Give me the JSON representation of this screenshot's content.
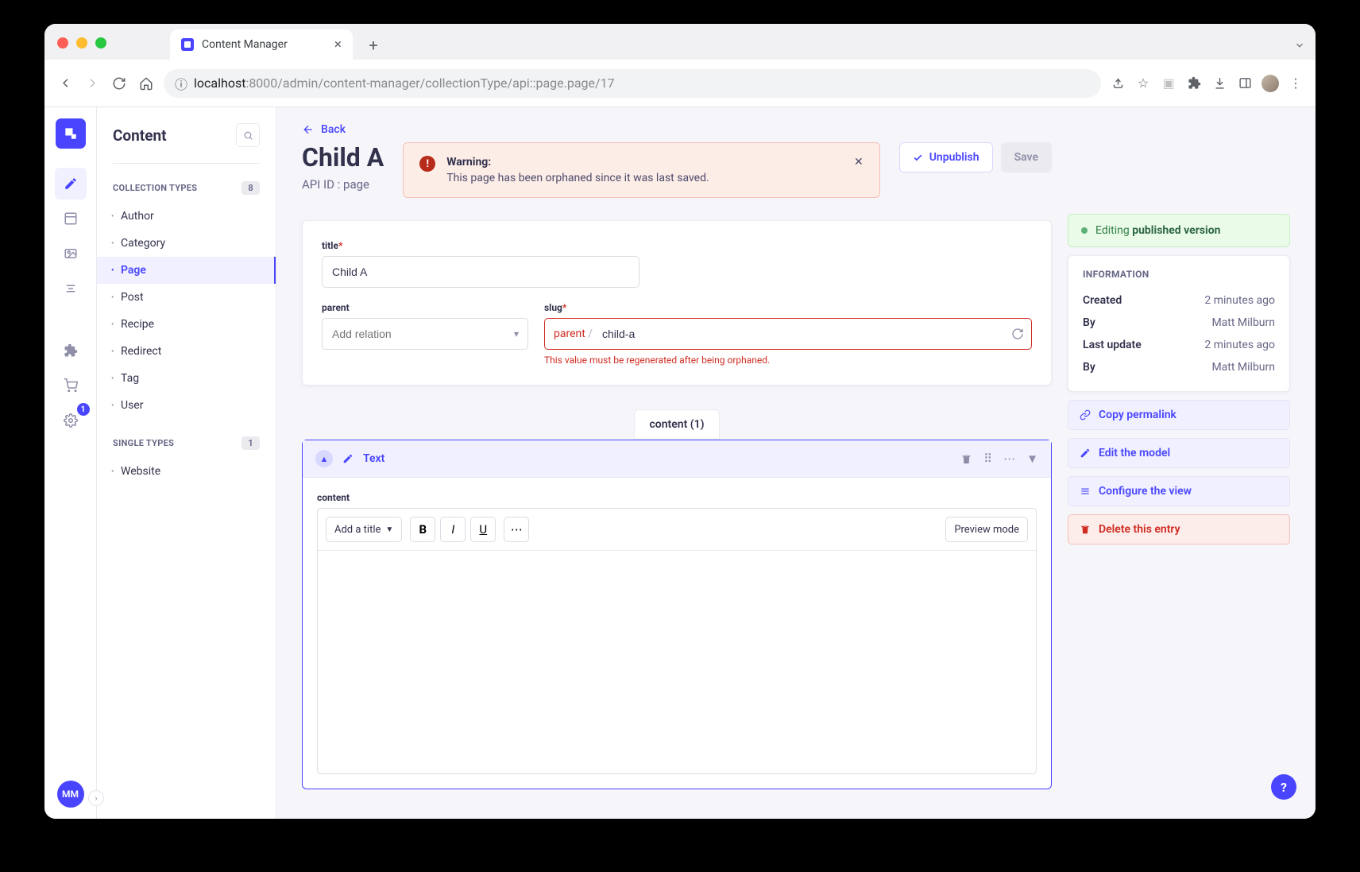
{
  "browser": {
    "tab_title": "Content Manager",
    "url_host": "localhost",
    "url_path": ":8000/admin/content-manager/collectionType/api::page.page/17"
  },
  "rail": {
    "user_initials": "MM",
    "settings_badge": "1"
  },
  "sidebar": {
    "title": "Content",
    "section_collection": "COLLECTION TYPES",
    "collection_count": "8",
    "collection_items": [
      "Author",
      "Category",
      "Page",
      "Post",
      "Recipe",
      "Redirect",
      "Tag",
      "User"
    ],
    "section_single": "SINGLE TYPES",
    "single_count": "1",
    "single_items": [
      "Website"
    ]
  },
  "header": {
    "back": "Back",
    "title": "Child A",
    "subtitle": "API ID : page",
    "unpublish": "Unpublish",
    "save": "Save"
  },
  "alert": {
    "title": "Warning:",
    "text": "This page has been orphaned since it was last saved."
  },
  "form": {
    "title_label": "title",
    "title_value": "Child A",
    "parent_label": "parent",
    "parent_placeholder": "Add relation",
    "slug_label": "slug",
    "slug_prefix": "parent",
    "slug_value": "child-a",
    "slug_error": "This value must be regenerated after being orphaned."
  },
  "dynzone": {
    "tab": "content (1)",
    "component_name": "Text",
    "content_label": "content",
    "title_dropdown": "Add a title",
    "preview": "Preview mode"
  },
  "pubstatus": {
    "prefix": "Editing",
    "bold": "published version"
  },
  "info": {
    "heading": "INFORMATION",
    "rows": [
      {
        "k": "Created",
        "v": "2 minutes ago"
      },
      {
        "k": "By",
        "v": "Matt Milburn"
      },
      {
        "k": "Last update",
        "v": "2 minutes ago"
      },
      {
        "k": "By",
        "v": "Matt Milburn"
      }
    ]
  },
  "actions": {
    "copy": "Copy permalink",
    "edit_model": "Edit the model",
    "configure": "Configure the view",
    "delete": "Delete this entry"
  },
  "help": "?"
}
